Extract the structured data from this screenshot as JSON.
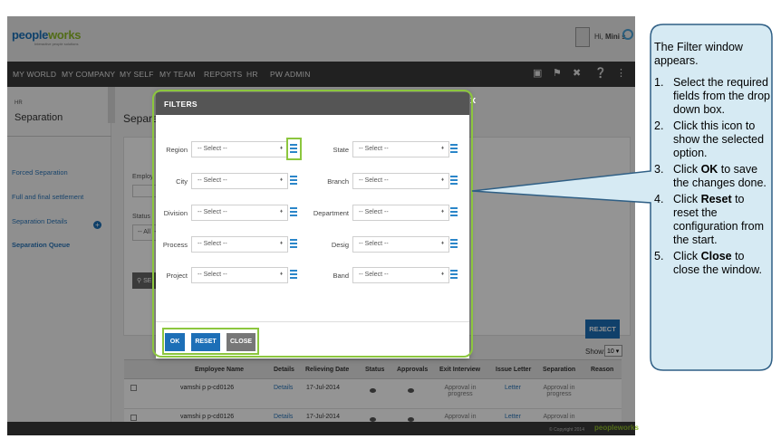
{
  "header": {
    "logo_main": "people",
    "logo_accent": "works",
    "logo_tag": "Interactive people solutions",
    "greeting_prefix": "Hi,",
    "greeting_name": "Mini s"
  },
  "nav": {
    "items": [
      "MY WORLD",
      "MY COMPANY",
      "MY SELF",
      "MY TEAM",
      "REPORTS",
      "HR",
      "PW ADMIN"
    ],
    "icons": [
      "book-icon",
      "flag-icon",
      "tools-icon",
      "help-icon",
      "share-icon"
    ]
  },
  "sidebar": {
    "section": "HR",
    "title": "Separation",
    "items": [
      "Forced Separation",
      "Full and final settlement",
      "Separation Details",
      "Separation Queue"
    ],
    "active_index": 3
  },
  "page": {
    "title": "Separa",
    "employee_label": "Employ",
    "status_label": "Status",
    "status_value": "-- All --",
    "search_label": "SE"
  },
  "grid": {
    "reject_label": "REJECT",
    "show_label": "Show:",
    "show_value": "10",
    "headers": [
      "Employee Name",
      "Details",
      "Relieving Date",
      "Status",
      "Approvals",
      "Exit Interview",
      "Issue Letter",
      "Separation",
      "Reason"
    ],
    "rows": [
      {
        "name": "vamshi p p-cd0126",
        "details": "Details",
        "date": "17-Jul-2014",
        "exit": "Approval in progress",
        "letter": "Letter",
        "separation": "Approval in progress"
      },
      {
        "name": "vamshi p p-cd0126",
        "details": "Details",
        "date": "17-Jul-2014",
        "exit": "Approval in",
        "letter": "Letter",
        "separation": "Approval in"
      }
    ]
  },
  "footer": {
    "copyright": "© Copyright 2014",
    "logo": "peopleworks"
  },
  "modal": {
    "title": "FILTERS",
    "close": "x",
    "placeholder": "-- Select --",
    "left_fields": [
      "Region",
      "City",
      "Division",
      "Process",
      "Project"
    ],
    "right_fields": [
      "State",
      "Branch",
      "Department",
      "Desig",
      "Band"
    ],
    "buttons": {
      "ok": "OK",
      "reset": "RESET",
      "close": "CLOSE"
    }
  },
  "callout": {
    "intro": "The Filter window appears.",
    "steps": [
      {
        "num": "1.",
        "parts": [
          {
            "t": "Select the required fields from the drop down box."
          }
        ]
      },
      {
        "num": "2.",
        "parts": [
          {
            "t": "Click this icon to show the selected option."
          }
        ]
      },
      {
        "num": "3.",
        "parts": [
          {
            "t": "Click "
          },
          {
            "t": "OK",
            "b": true
          },
          {
            "t": " to save the changes done."
          }
        ]
      },
      {
        "num": "4.",
        "parts": [
          {
            "t": "Click "
          },
          {
            "t": "Reset",
            "b": true
          },
          {
            "t": " to reset the configuration from the start."
          }
        ]
      },
      {
        "num": "5.",
        "parts": [
          {
            "t": "Click "
          },
          {
            "t": "Close",
            "b": true
          },
          {
            "t": " to close the window."
          }
        ]
      }
    ]
  },
  "colors": {
    "highlight": "#8cc63e",
    "callout_fill": "#d6eaf3",
    "callout_stroke": "#2f5f85",
    "primary": "#1d6fb7"
  }
}
